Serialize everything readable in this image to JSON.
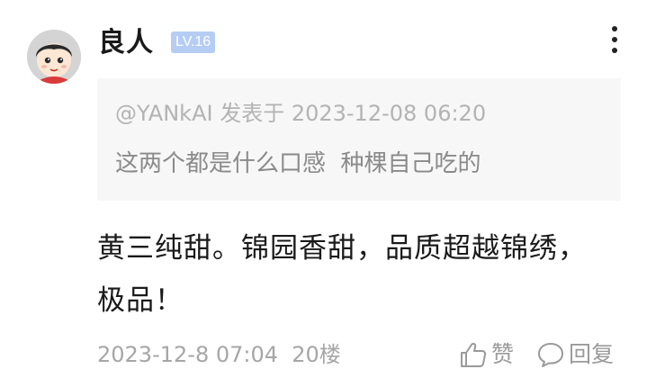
{
  "comment": {
    "username": "良人",
    "level": "LV.16",
    "quote": {
      "meta": "@YANkAI 发表于 2023-12-08 06:20",
      "text": "这两个都是什么口感  种棵自己吃的"
    },
    "body": "黄三纯甜。锦园香甜，品质超越锦绣，极品！",
    "timestamp": "2023-12-8 07:04",
    "floor": "20楼",
    "actions": {
      "like_label": "赞",
      "like_icon": "thumbs-up-icon",
      "reply_label": "回复",
      "reply_icon": "speech-bubble-icon"
    }
  },
  "colors": {
    "badge_bg": "#b5cdf3",
    "quote_bg": "#f7f7f7",
    "meta_text": "#a6a6a6"
  }
}
